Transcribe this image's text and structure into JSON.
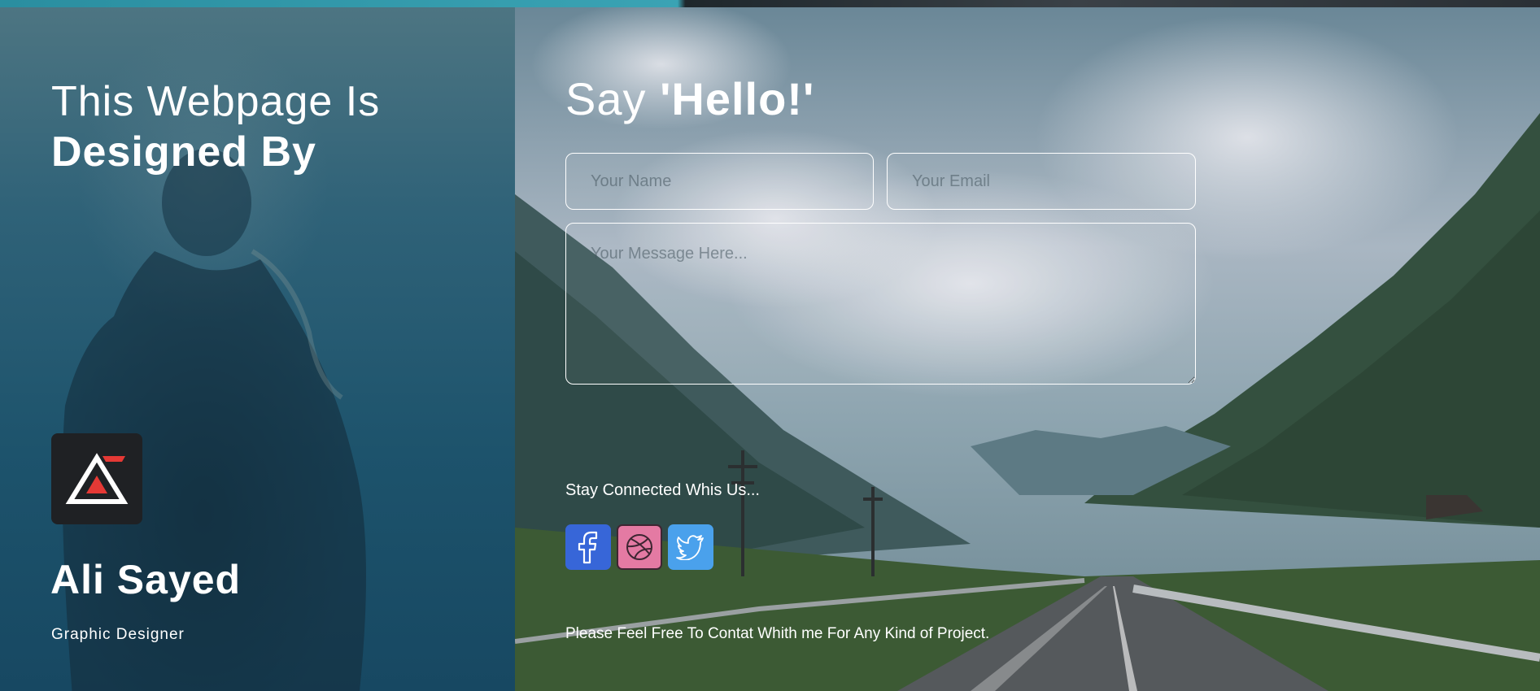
{
  "left": {
    "title_line1": "This Webpage Is",
    "title_line2": "Designed By",
    "logo_icon": "triangle-logo-icon",
    "author_name": "Ali Sayed",
    "author_role": "Graphic Designer"
  },
  "right": {
    "title_regular": "Say ",
    "title_bold": "'Hello!'",
    "form": {
      "name_placeholder": "Your Name",
      "email_placeholder": "Your Email",
      "message_placeholder": "Your Message Here..."
    },
    "stay_connected": "Stay Connected Whis Us...",
    "social": [
      {
        "name": "facebook",
        "icon": "facebook-icon",
        "color": "#3766d8"
      },
      {
        "name": "dribbble",
        "icon": "dribbble-icon",
        "color": "#e47aa3"
      },
      {
        "name": "twitter",
        "icon": "twitter-icon",
        "color": "#4aa1ec"
      }
    ],
    "footer_note": "Please Feel Free To Contat Whith me For Any Kind of Project."
  },
  "colors": {
    "left_overlay": "#1d536c",
    "accent_red": "#e53935",
    "logo_bg": "#1f2124"
  }
}
